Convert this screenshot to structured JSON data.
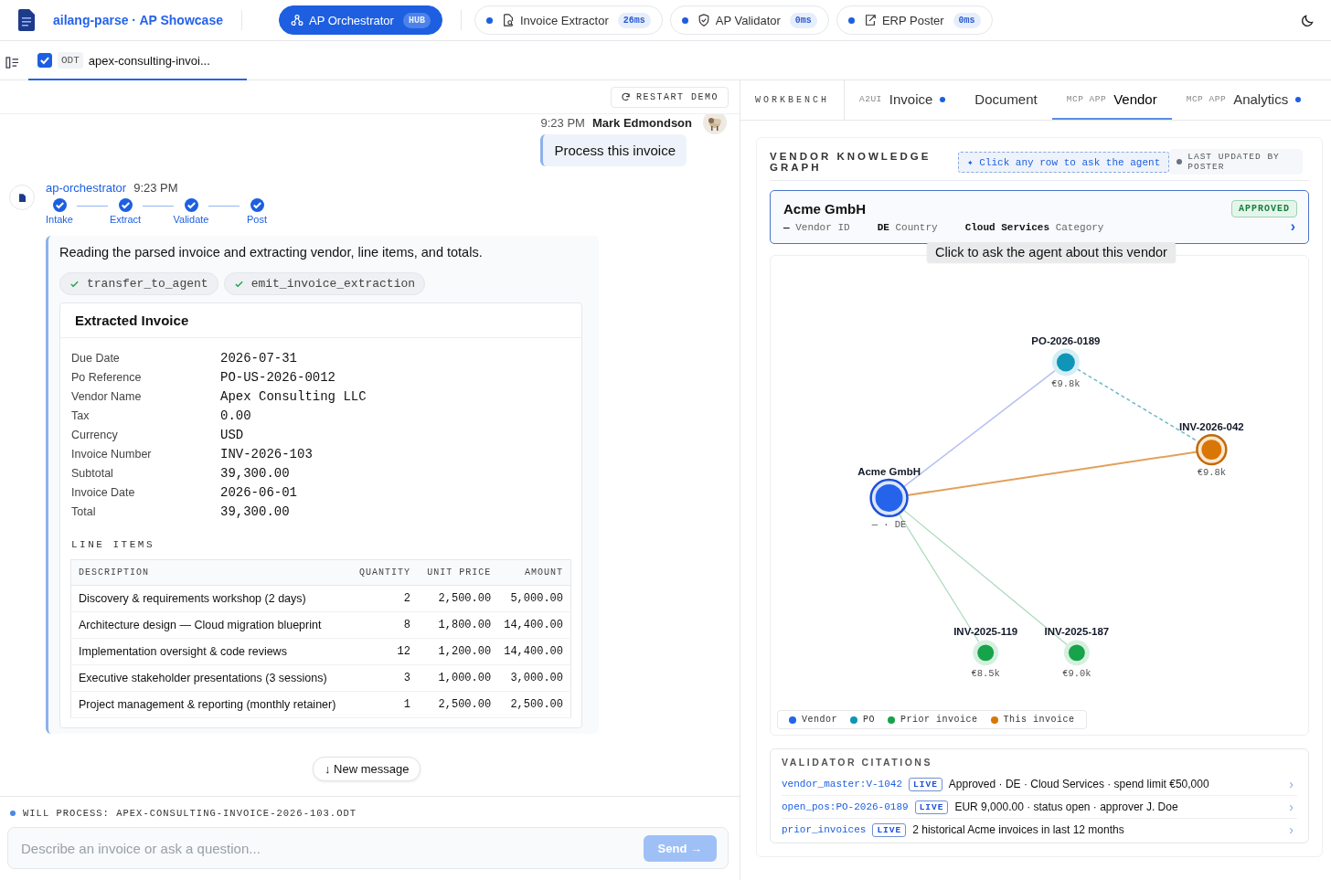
{
  "header": {
    "app_title": "ailang-parse · AP Showcase",
    "agents": [
      {
        "name": "AP Orchestrator",
        "badge": "HUB",
        "selected": true,
        "kind": "hub",
        "online": false
      },
      {
        "name": "Invoice Extractor",
        "badge": "26ms",
        "selected": false,
        "kind": "extract",
        "online": true
      },
      {
        "name": "AP Validator",
        "badge": "0ms",
        "selected": false,
        "kind": "validate",
        "online": true
      },
      {
        "name": "ERP Poster",
        "badge": "0ms",
        "selected": false,
        "kind": "post",
        "online": true
      }
    ]
  },
  "file_tabs": [
    {
      "type": "ODT",
      "name": "apex-consulting-invoi...",
      "checked": true,
      "selected": true
    }
  ],
  "chat": {
    "restart": "RESTART DEMO",
    "user_message": {
      "time": "9:23 PM",
      "author": "Mark Edmondson",
      "text": "Process this invoice"
    },
    "agent_message": {
      "name": "ap-orchestrator",
      "time": "9:23 PM",
      "steps": [
        {
          "label": "Intake",
          "done": true
        },
        {
          "label": "Extract",
          "done": true
        },
        {
          "label": "Validate",
          "done": true
        },
        {
          "label": "Post",
          "done": true
        }
      ],
      "text": "Reading the parsed invoice and extracting vendor, line items, and totals.",
      "tools": [
        {
          "name": "transfer_to_agent",
          "ok": true
        },
        {
          "name": "emit_invoice_extraction",
          "ok": true
        }
      ],
      "card_title": "Extracted Invoice",
      "fields": [
        {
          "label": "Due Date",
          "value": "2026-07-31"
        },
        {
          "label": "Po Reference",
          "value": "PO-US-2026-0012"
        },
        {
          "label": "Vendor Name",
          "value": "Apex Consulting LLC"
        },
        {
          "label": "Tax",
          "value": "0.00"
        },
        {
          "label": "Currency",
          "value": "USD"
        },
        {
          "label": "Invoice Number",
          "value": "INV-2026-103"
        },
        {
          "label": "Subtotal",
          "value": "39,300.00"
        },
        {
          "label": "Invoice Date",
          "value": "2026-06-01"
        },
        {
          "label": "Total",
          "value": "39,300.00"
        }
      ],
      "line_items_title": "LINE ITEMS",
      "columns": [
        "DESCRIPTION",
        "QUANTITY",
        "UNIT PRICE",
        "AMOUNT"
      ],
      "rows": [
        [
          "Discovery & requirements workshop (2 days)",
          "2",
          "2,500.00",
          "5,000.00"
        ],
        [
          "Architecture design — Cloud migration blueprint",
          "8",
          "1,800.00",
          "14,400.00"
        ],
        [
          "Implementation oversight & code reviews",
          "12",
          "1,200.00",
          "14,400.00"
        ],
        [
          "Executive stakeholder presentations (3 sessions)",
          "3",
          "1,000.00",
          "3,000.00"
        ],
        [
          "Project management & reporting (monthly retainer)",
          "1",
          "2,500.00",
          "2,500.00"
        ]
      ]
    },
    "new_message": "↓ New message",
    "will_process": "WILL PROCESS: APEX-CONSULTING-INVOICE-2026-103.ODT",
    "placeholder": "Describe an invoice or ask a question...",
    "send": {
      "label": "Send →",
      "disabled": true
    }
  },
  "workbench": {
    "label": "WORKBENCH",
    "tabs": [
      {
        "prefix": "A2UI",
        "label": "Invoice",
        "dot": true,
        "selected": false
      },
      {
        "label": "Document",
        "dot": false,
        "selected": false
      },
      {
        "prefix": "MCP APP",
        "label": "Vendor",
        "dot": false,
        "selected": true
      },
      {
        "prefix": "MCP APP",
        "label": "Analytics",
        "dot": true,
        "selected": false
      }
    ],
    "title": "VENDOR KNOWLEDGE GRAPH",
    "hint": "✦ Click any row to ask the agent",
    "last_updated": "LAST UPDATED BY POSTER",
    "vendor": {
      "name": "Acme GmbH",
      "status": "APPROVED",
      "chevron": "›",
      "meta": [
        {
          "value": "—",
          "label": "Vendor ID"
        },
        {
          "value": "DE",
          "label": "Country"
        },
        {
          "value": "Cloud Services",
          "label": "Category"
        }
      ]
    },
    "tooltip": "Click to ask the agent about this vendor",
    "graph": {
      "nodes": [
        {
          "label": "PO-2026-0189",
          "sub": "€9.8k",
          "kind": "po"
        },
        {
          "label": "INV-2026-042",
          "sub": "€9.8k",
          "kind": "this"
        },
        {
          "label": "Acme GmbH",
          "sub": "— · DE",
          "kind": "vendor"
        },
        {
          "label": "INV-2025-119",
          "sub": "€8.5k",
          "kind": "prior"
        },
        {
          "label": "INV-2025-187",
          "sub": "€9.0k",
          "kind": "prior"
        }
      ],
      "legend": [
        {
          "label": "Vendor",
          "color": "#2563eb"
        },
        {
          "label": "PO",
          "color": "#0e95b8"
        },
        {
          "label": "Prior invoice",
          "color": "#16a34a"
        },
        {
          "label": "This invoice",
          "color": "#d97706"
        }
      ]
    },
    "citations": {
      "title": "VALIDATOR CITATIONS",
      "rows": [
        {
          "source": "vendor_master:V-1042",
          "badge": "LIVE",
          "text": "Approved · DE · Cloud Services · spend limit €50,000",
          "chevron": "›"
        },
        {
          "source": "open_pos:PO-2026-0189",
          "badge": "LIVE",
          "text": "EUR 9,000.00 · status open · approver J. Doe",
          "chevron": "›"
        },
        {
          "source": "prior_invoices",
          "badge": "LIVE",
          "text": "2 historical Acme invoices in last 12 months",
          "chevron": "›"
        }
      ]
    }
  }
}
